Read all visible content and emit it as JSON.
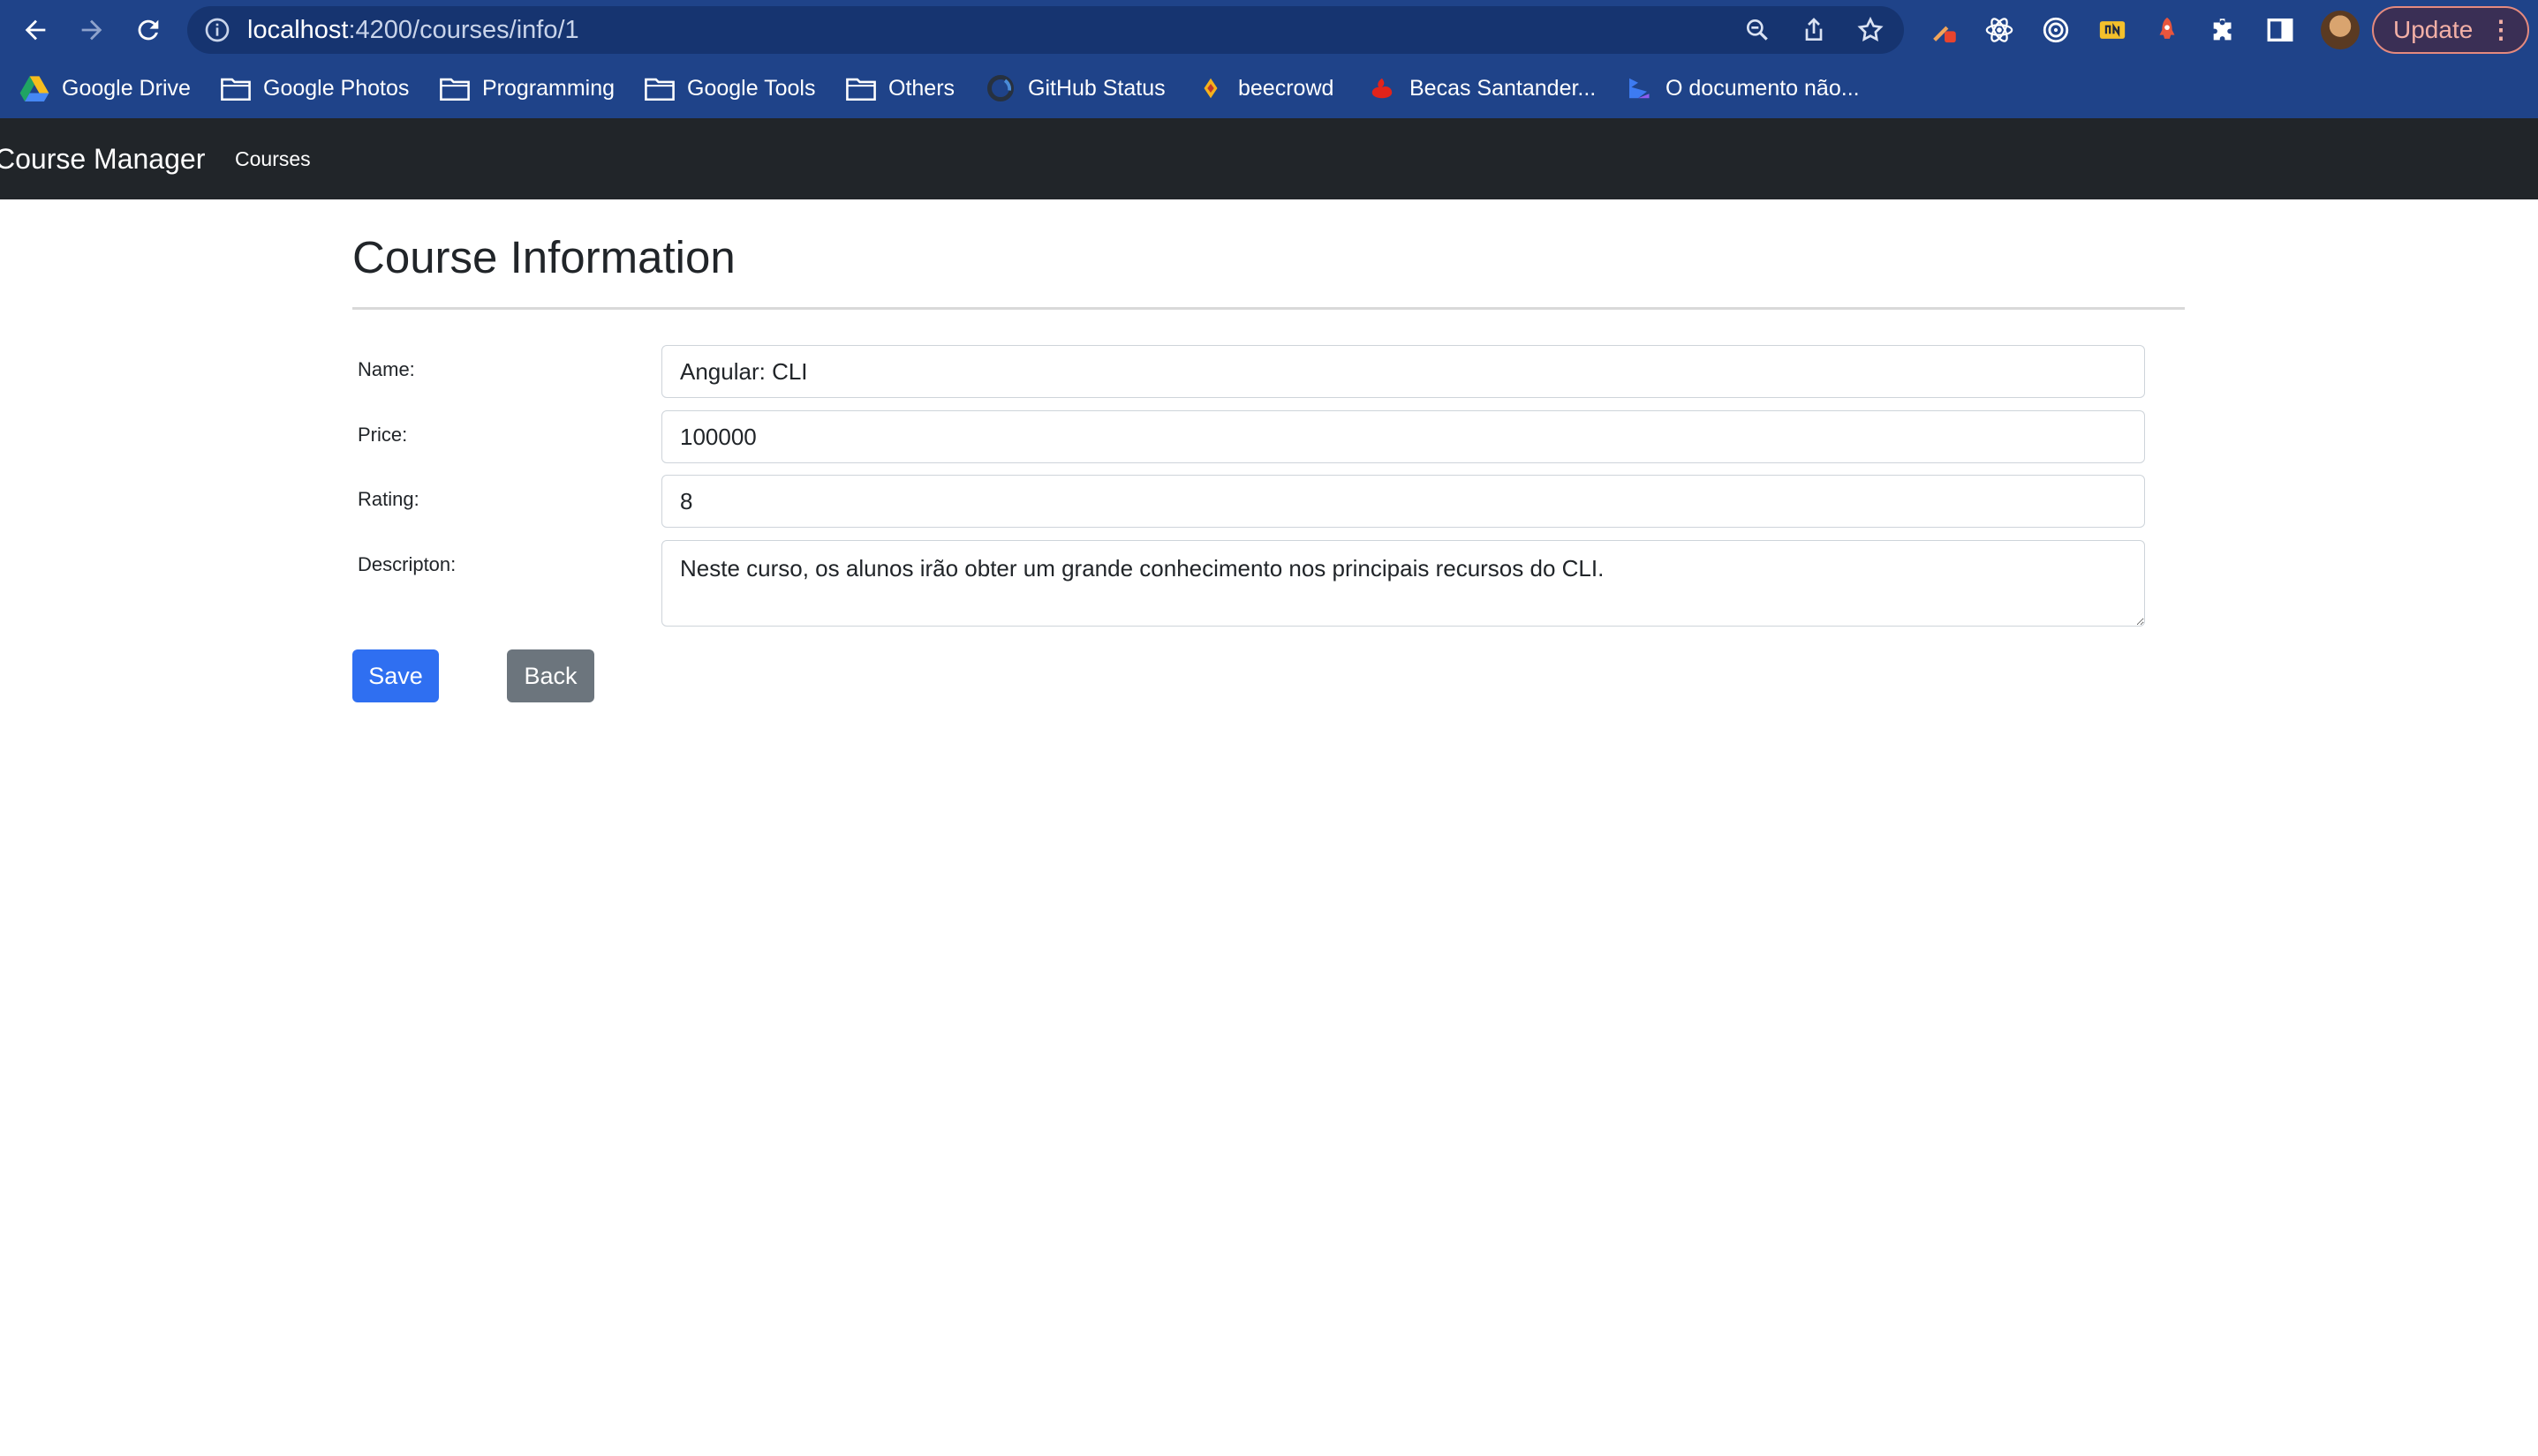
{
  "browser": {
    "url_host": "localhost",
    "url_path": ":4200/courses/info/1",
    "update_label": "Update",
    "menu_label": "⋮",
    "bookmarks": [
      {
        "label": "Google Drive",
        "icon": "google-drive-icon"
      },
      {
        "label": "Google Photos",
        "icon": "folder-icon"
      },
      {
        "label": "Programming",
        "icon": "folder-icon"
      },
      {
        "label": "Google Tools",
        "icon": "folder-icon"
      },
      {
        "label": "Others",
        "icon": "folder-icon"
      },
      {
        "label": "GitHub Status",
        "icon": "github-icon"
      },
      {
        "label": "beecrowd",
        "icon": "beecrowd-icon"
      },
      {
        "label": "Becas Santander...",
        "icon": "santander-icon"
      },
      {
        "label": "O documento não...",
        "icon": "document-icon"
      }
    ],
    "colors": {
      "chrome": "#1f4389",
      "omnibox": "#163470"
    }
  },
  "app_nav": {
    "brand": "Course Manager",
    "links": [
      "Courses"
    ],
    "color": "#212529"
  },
  "form": {
    "title": "Course Information",
    "name_label": "Name:",
    "name_value": "Angular: CLI",
    "price_label": "Price:",
    "price_value": "100000",
    "rating_label": "Rating:",
    "rating_value": "8",
    "description_label": "Descripton:",
    "description_value": "Neste curso, os alunos irão obter um grande conhecimento nos principais recursos do CLI.",
    "save_label": "Save",
    "back_label": "Back",
    "colors": {
      "save": "#2f6ff1",
      "back": "#6c757d"
    }
  }
}
